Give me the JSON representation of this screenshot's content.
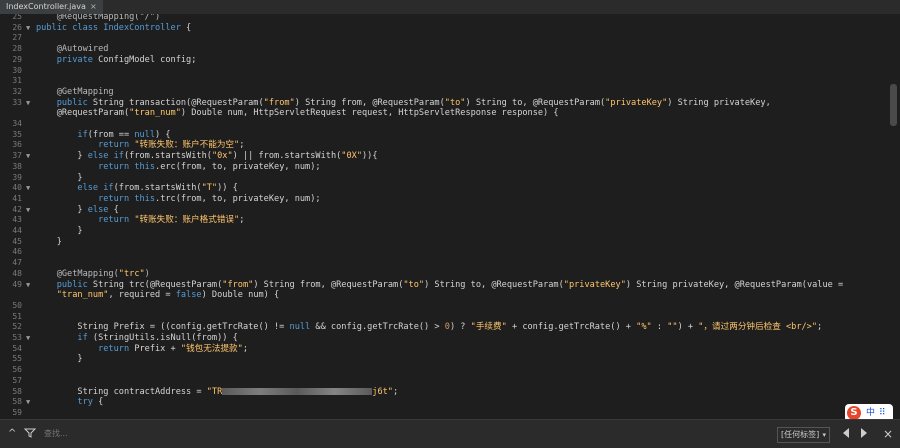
{
  "tab": {
    "title": "IndexController.java",
    "close": "×"
  },
  "lines": [
    {
      "n": "25",
      "fold": "",
      "segs": [
        {
          "t": "    @RequestMapping(\"/\")",
          "c": "ann"
        }
      ]
    },
    {
      "n": "26",
      "fold": "▼",
      "segs": [
        {
          "t": "public class ",
          "c": "kw"
        },
        {
          "t": "IndexController",
          "c": "kw"
        },
        {
          "t": " {",
          "c": ""
        }
      ]
    },
    {
      "n": "27",
      "fold": "",
      "segs": []
    },
    {
      "n": "28",
      "fold": "",
      "segs": [
        {
          "t": "    @Autowired",
          "c": "ann"
        }
      ]
    },
    {
      "n": "29",
      "fold": "",
      "segs": [
        {
          "t": "    private ",
          "c": "kw"
        },
        {
          "t": "ConfigModel config;",
          "c": ""
        }
      ]
    },
    {
      "n": "30",
      "fold": "",
      "segs": []
    },
    {
      "n": "31",
      "fold": "",
      "segs": []
    },
    {
      "n": "32",
      "fold": "",
      "segs": [
        {
          "t": "    @GetMapping",
          "c": "ann"
        }
      ]
    },
    {
      "n": "33",
      "fold": "▼",
      "segs": [
        {
          "t": "    public ",
          "c": "kw"
        },
        {
          "t": "String transaction(@RequestParam(",
          "c": ""
        },
        {
          "t": "\"from\"",
          "c": "str"
        },
        {
          "t": ") String from, @RequestParam(",
          "c": ""
        },
        {
          "t": "\"to\"",
          "c": "str"
        },
        {
          "t": ") String to, @RequestParam(",
          "c": ""
        },
        {
          "t": "\"privateKey\"",
          "c": "str"
        },
        {
          "t": ") String privateKey,",
          "c": ""
        }
      ]
    },
    {
      "n": "",
      "fold": "",
      "segs": [
        {
          "t": "    @RequestParam(",
          "c": ""
        },
        {
          "t": "\"tran_num\"",
          "c": "str"
        },
        {
          "t": ") Double num, HttpServletRequest request, HttpServletResponse response) {",
          "c": ""
        }
      ]
    },
    {
      "n": "34",
      "fold": "",
      "segs": []
    },
    {
      "n": "35",
      "fold": "",
      "segs": [
        {
          "t": "        if",
          "c": "kw"
        },
        {
          "t": "(from == ",
          "c": ""
        },
        {
          "t": "null",
          "c": "kw"
        },
        {
          "t": ") {",
          "c": ""
        }
      ]
    },
    {
      "n": "36",
      "fold": "",
      "segs": [
        {
          "t": "            return ",
          "c": "kw"
        },
        {
          "t": "\"转账失败：账户不能为空\"",
          "c": "str"
        },
        {
          "t": ";",
          "c": ""
        }
      ]
    },
    {
      "n": "37",
      "fold": "▼",
      "segs": [
        {
          "t": "        } ",
          "c": ""
        },
        {
          "t": "else if",
          "c": "kw"
        },
        {
          "t": "(from.startsWith(",
          "c": ""
        },
        {
          "t": "\"0x\"",
          "c": "str"
        },
        {
          "t": ") || from.startsWith(",
          "c": ""
        },
        {
          "t": "\"0X\"",
          "c": "str"
        },
        {
          "t": ")){",
          "c": ""
        }
      ]
    },
    {
      "n": "38",
      "fold": "",
      "segs": [
        {
          "t": "            return ",
          "c": "kw"
        },
        {
          "t": "this",
          "c": "kw"
        },
        {
          "t": ".erc(from, to, privateKey, num);",
          "c": ""
        }
      ]
    },
    {
      "n": "39",
      "fold": "",
      "segs": [
        {
          "t": "        }",
          "c": ""
        }
      ]
    },
    {
      "n": "40",
      "fold": "▼",
      "segs": [
        {
          "t": "        else if",
          "c": "kw"
        },
        {
          "t": "(from.startsWith(",
          "c": ""
        },
        {
          "t": "\"T\"",
          "c": "str"
        },
        {
          "t": ")) {",
          "c": ""
        }
      ]
    },
    {
      "n": "41",
      "fold": "",
      "segs": [
        {
          "t": "            return ",
          "c": "kw"
        },
        {
          "t": "this",
          "c": "kw"
        },
        {
          "t": ".trc(from, to, privateKey, num);",
          "c": ""
        }
      ]
    },
    {
      "n": "42",
      "fold": "▼",
      "segs": [
        {
          "t": "        } ",
          "c": ""
        },
        {
          "t": "else",
          "c": "kw"
        },
        {
          "t": " {",
          "c": ""
        }
      ]
    },
    {
      "n": "43",
      "fold": "",
      "segs": [
        {
          "t": "            return ",
          "c": "kw"
        },
        {
          "t": "\"转账失败：账户格式错误\"",
          "c": "str"
        },
        {
          "t": ";",
          "c": ""
        }
      ]
    },
    {
      "n": "44",
      "fold": "",
      "segs": [
        {
          "t": "        }",
          "c": ""
        }
      ]
    },
    {
      "n": "45",
      "fold": "",
      "segs": [
        {
          "t": "    }",
          "c": ""
        }
      ]
    },
    {
      "n": "46",
      "fold": "",
      "segs": []
    },
    {
      "n": "47",
      "fold": "",
      "segs": []
    },
    {
      "n": "48",
      "fold": "",
      "segs": [
        {
          "t": "    @GetMapping(",
          "c": "ann"
        },
        {
          "t": "\"trc\"",
          "c": "str"
        },
        {
          "t": ")",
          "c": "ann"
        }
      ]
    },
    {
      "n": "49",
      "fold": "▼",
      "segs": [
        {
          "t": "    public ",
          "c": "kw"
        },
        {
          "t": "String trc(@RequestParam(",
          "c": ""
        },
        {
          "t": "\"from\"",
          "c": "str"
        },
        {
          "t": ") String from, @RequestParam(",
          "c": ""
        },
        {
          "t": "\"to\"",
          "c": "str"
        },
        {
          "t": ") String to, @RequestParam(",
          "c": ""
        },
        {
          "t": "\"privateKey\"",
          "c": "str"
        },
        {
          "t": ") String privateKey, @RequestParam(value =",
          "c": ""
        }
      ]
    },
    {
      "n": "",
      "fold": "",
      "segs": [
        {
          "t": "    \"tran_num\"",
          "c": "str"
        },
        {
          "t": ", required = ",
          "c": ""
        },
        {
          "t": "false",
          "c": "kw"
        },
        {
          "t": ") Double num) {",
          "c": ""
        }
      ]
    },
    {
      "n": "50",
      "fold": "",
      "segs": []
    },
    {
      "n": "51",
      "fold": "",
      "segs": []
    },
    {
      "n": "52",
      "fold": "",
      "segs": [
        {
          "t": "        String Prefix = ((config.getTrcRate() != ",
          "c": ""
        },
        {
          "t": "null",
          "c": "kw"
        },
        {
          "t": " && config.getTrcRate() > ",
          "c": ""
        },
        {
          "t": "0",
          "c": "num"
        },
        {
          "t": ") ? ",
          "c": ""
        },
        {
          "t": "\"手续费\"",
          "c": "str"
        },
        {
          "t": " + config.getTrcRate() + ",
          "c": ""
        },
        {
          "t": "\"%\"",
          "c": "str"
        },
        {
          "t": " : ",
          "c": ""
        },
        {
          "t": "\"\"",
          "c": "str"
        },
        {
          "t": ") + ",
          "c": ""
        },
        {
          "t": "\"，请过两分钟后检查 <br/>\"",
          "c": "str"
        },
        {
          "t": ";",
          "c": ""
        }
      ]
    },
    {
      "n": "53",
      "fold": "▼",
      "segs": [
        {
          "t": "        if",
          "c": "kw"
        },
        {
          "t": " (StringUtils.isNull(from)) {",
          "c": ""
        }
      ]
    },
    {
      "n": "54",
      "fold": "",
      "segs": [
        {
          "t": "            return ",
          "c": "kw"
        },
        {
          "t": "Prefix + ",
          "c": ""
        },
        {
          "t": "\"钱包无法提款\"",
          "c": "str"
        },
        {
          "t": ";",
          "c": ""
        }
      ]
    },
    {
      "n": "55",
      "fold": "",
      "segs": [
        {
          "t": "        }",
          "c": ""
        }
      ]
    },
    {
      "n": "56",
      "fold": "",
      "segs": []
    },
    {
      "n": "57",
      "fold": "",
      "segs": []
    },
    {
      "n": "58",
      "fold": "",
      "segs": [
        {
          "t": "        String contractAddress = ",
          "c": ""
        },
        {
          "t": "\"TR",
          "c": "str"
        },
        {
          "t": "§BLUR§",
          "c": "blur"
        },
        {
          "t": "j6t\"",
          "c": "str"
        },
        {
          "t": ";",
          "c": ""
        }
      ]
    },
    {
      "n": "58",
      "fold": "▼",
      "segs": [
        {
          "t": "        try",
          "c": "kw"
        },
        {
          "t": " {",
          "c": ""
        }
      ]
    },
    {
      "n": "59",
      "fold": "",
      "segs": []
    }
  ],
  "ime": {
    "logo": "S",
    "lang": "中",
    "grid": "⠿"
  },
  "findbar": {
    "up_icon": "^",
    "search_placeholder": "查找...",
    "tag_select": "[任何标签]",
    "close": "×"
  }
}
